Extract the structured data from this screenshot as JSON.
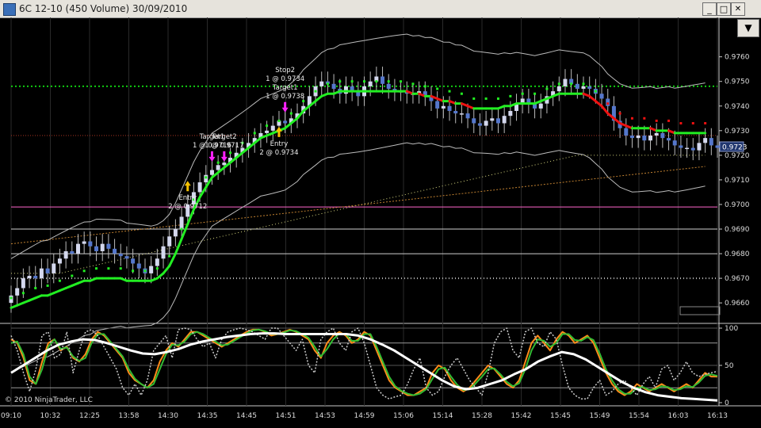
{
  "window": {
    "title": "6C 12-10 (450 Volume)  30/09/2010",
    "min_btn": "_",
    "max_btn": "□",
    "close_btn": "✕",
    "dropdown_glyph": "▼"
  },
  "colors": {
    "bar_up": "#d4d8ee",
    "bar_down": "#5577cc",
    "ma_up": "#22ee22",
    "ma_down": "#ee1111",
    "stoch_k": "#ff8c1a",
    "stoch_d": "#33bb33",
    "stoch_fast": "#cccccc",
    "long_line": "#ffffff",
    "magenta_line": "#ff66cc",
    "green_dotted": "#11cc11",
    "current_price": "#20366e"
  },
  "chart_data": [
    {
      "type": "candlestick",
      "instrument": "6C 12-10",
      "bar_type": "450 Volume",
      "date": "30/09/2010",
      "ylim": [
        0.9652,
        0.9776
      ],
      "y_ticks": [
        "0.9760",
        "0.9750",
        "0.9740",
        "0.9730",
        "0.9720",
        "0.9710",
        "0.9700",
        "0.9690",
        "0.9680",
        "0.9670",
        "0.9660"
      ],
      "x_ticks": [
        "09:10",
        "10:32",
        "12:25",
        "13:58",
        "14:30",
        "14:35",
        "14:45",
        "14:51",
        "14:53",
        "14:59",
        "15:06",
        "15:14",
        "15:28",
        "15:42",
        "15:45",
        "15:49",
        "15:54",
        "16:03",
        "16:13"
      ],
      "current_price_label": "0.9723",
      "closes": [
        0.9663,
        0.9666,
        0.967,
        0.9671,
        0.967,
        0.9674,
        0.9672,
        0.9676,
        0.9678,
        0.9681,
        0.968,
        0.9684,
        0.9685,
        0.9683,
        0.9681,
        0.9684,
        0.9682,
        0.968,
        0.9679,
        0.9678,
        0.9676,
        0.9674,
        0.9672,
        0.9675,
        0.9678,
        0.9683,
        0.9687,
        0.969,
        0.9695,
        0.97,
        0.9705,
        0.9709,
        0.9712,
        0.9714,
        0.9716,
        0.9717,
        0.9719,
        0.9721,
        0.9723,
        0.9725,
        0.9727,
        0.9729,
        0.973,
        0.9732,
        0.9734,
        0.9733,
        0.9735,
        0.9737,
        0.974,
        0.9744,
        0.9748,
        0.975,
        0.9749,
        0.9747,
        0.9745,
        0.9748,
        0.9746,
        0.9744,
        0.9748,
        0.975,
        0.9752,
        0.9749,
        0.9747,
        0.9746,
        0.9746,
        0.9745,
        0.9745,
        0.9746,
        0.9744,
        0.9742,
        0.9739,
        0.974,
        0.9738,
        0.9737,
        0.9737,
        0.9735,
        0.9733,
        0.9732,
        0.9734,
        0.9735,
        0.9733,
        0.9736,
        0.9738,
        0.9741,
        0.9743,
        0.9741,
        0.9739,
        0.9741,
        0.9744,
        0.9746,
        0.9748,
        0.9751,
        0.9749,
        0.9747,
        0.9748,
        0.9747,
        0.9745,
        0.9743,
        0.974,
        0.9734,
        0.9731,
        0.9728,
        0.9727,
        0.9728,
        0.9726,
        0.9728,
        0.9729,
        0.9727,
        0.9726,
        0.9724,
        0.9723,
        0.9723,
        0.9722,
        0.9725,
        0.9727,
        0.9724,
        0.9723
      ],
      "moving_average": [
        0.9658,
        0.9659,
        0.966,
        0.9661,
        0.9662,
        0.9663,
        0.9663,
        0.9664,
        0.9665,
        0.9666,
        0.9667,
        0.9668,
        0.9669,
        0.9669,
        0.967,
        0.967,
        0.967,
        0.967,
        0.967,
        0.9669,
        0.9669,
        0.9669,
        0.9669,
        0.9669,
        0.967,
        0.9672,
        0.9675,
        0.968,
        0.9686,
        0.9692,
        0.9698,
        0.9703,
        0.9707,
        0.9711,
        0.9713,
        0.9715,
        0.9717,
        0.9719,
        0.9721,
        0.9723,
        0.9725,
        0.9727,
        0.9728,
        0.9729,
        0.973,
        0.9731,
        0.9733,
        0.9735,
        0.9738,
        0.974,
        0.9742,
        0.9744,
        0.9745,
        0.9745,
        0.9746,
        0.9746,
        0.9746,
        0.9746,
        0.9746,
        0.9746,
        0.9746,
        0.9746,
        0.9746,
        0.9746,
        0.9746,
        0.9746,
        0.9745,
        0.9745,
        0.9744,
        0.9744,
        0.9743,
        0.9742,
        0.9742,
        0.9741,
        0.9741,
        0.974,
        0.9739,
        0.9739,
        0.9739,
        0.9739,
        0.9739,
        0.974,
        0.974,
        0.9741,
        0.9741,
        0.9741,
        0.9741,
        0.9742,
        0.9743,
        0.9744,
        0.9745,
        0.9745,
        0.9745,
        0.9745,
        0.9745,
        0.9744,
        0.9742,
        0.974,
        0.9737,
        0.9735,
        0.9733,
        0.9732,
        0.9731,
        0.9731,
        0.9731,
        0.9731,
        0.973,
        0.973,
        0.973,
        0.9729,
        0.9729,
        0.9729,
        0.9729,
        0.9729,
        0.9729
      ],
      "trade_markers": [
        {
          "lines": [
            "Entry",
            "2 @ 0.9712"
          ],
          "price": 0.9707,
          "bar": 29,
          "kind": "long"
        },
        {
          "lines": [
            "Target1",
            "1 @ 0.9716"
          ],
          "price": 0.972,
          "bar": 33,
          "kind": "exit"
        },
        {
          "lines": [
            "Target2",
            "1 @ 0.9717"
          ],
          "price": 0.972,
          "bar": 35,
          "kind": "exit"
        },
        {
          "lines": [
            "Entry",
            "2 @ 0.9734"
          ],
          "price": 0.9729,
          "bar": 44,
          "kind": "long"
        },
        {
          "lines": [
            "Stop2",
            "1 @ 0.9734",
            "Target1",
            "1 @ 0.9738"
          ],
          "price": 0.974,
          "bar": 45,
          "kind": "exit"
        }
      ],
      "horizontal_levels": [
        {
          "price": 0.9748,
          "style": "green-dotted"
        },
        {
          "price": 0.9728,
          "style": "red-dotted"
        },
        {
          "price": 0.9699,
          "style": "magenta"
        },
        {
          "price": 0.967,
          "style": "gray-dotted"
        }
      ],
      "copyright": "© 2010 NinjaTrader, LLC"
    },
    {
      "type": "line",
      "ylim": [
        0,
        100
      ],
      "y_ticks": [
        "100",
        "50",
        "0"
      ],
      "series": [
        {
          "role": "stoch_k",
          "values": [
            85,
            80,
            60,
            30,
            25,
            55,
            80,
            85,
            70,
            75,
            60,
            55,
            65,
            85,
            95,
            90,
            80,
            70,
            60,
            40,
            30,
            25,
            20,
            30,
            55,
            70,
            80,
            75,
            85,
            95,
            95,
            90,
            85,
            80,
            75,
            80,
            85,
            90,
            95,
            98,
            98,
            95,
            90,
            92,
            95,
            98,
            95,
            90,
            85,
            70,
            60,
            80,
            90,
            95,
            90,
            80,
            85,
            95,
            90,
            70,
            50,
            30,
            20,
            15,
            10,
            10,
            15,
            20,
            40,
            50,
            45,
            30,
            20,
            15,
            20,
            30,
            40,
            50,
            45,
            35,
            25,
            20,
            30,
            55,
            80,
            90,
            80,
            70,
            85,
            95,
            90,
            80,
            85,
            90,
            80,
            60,
            40,
            25,
            15,
            10,
            15,
            25,
            20,
            15,
            20,
            25,
            20,
            15,
            20,
            25,
            20,
            30,
            40,
            35,
            35
          ]
        },
        {
          "role": "stoch_d",
          "values": [
            80,
            82,
            65,
            35,
            25,
            45,
            75,
            85,
            72,
            74,
            62,
            56,
            60,
            80,
            92,
            92,
            82,
            72,
            62,
            45,
            32,
            25,
            20,
            25,
            45,
            65,
            78,
            77,
            82,
            92,
            95,
            92,
            87,
            82,
            77,
            78,
            83,
            88,
            93,
            97,
            98,
            96,
            92,
            92,
            94,
            97,
            96,
            92,
            87,
            75,
            62,
            72,
            85,
            93,
            92,
            83,
            83,
            92,
            92,
            75,
            55,
            35,
            22,
            16,
            12,
            10,
            12,
            18,
            32,
            45,
            47,
            35,
            24,
            17,
            18,
            26,
            35,
            45,
            46,
            38,
            28,
            22,
            26,
            45,
            70,
            85,
            83,
            75,
            80,
            92,
            92,
            84,
            83,
            88,
            84,
            66,
            45,
            30,
            18,
            12,
            12,
            20,
            21,
            17,
            18,
            22,
            21,
            17,
            18,
            22,
            21,
            27,
            36,
            38,
            36
          ]
        },
        {
          "role": "stoch_fast",
          "values": [
            90,
            70,
            40,
            15,
            45,
            90,
            95,
            60,
            65,
            95,
            40,
            70,
            95,
            98,
            90,
            75,
            60,
            45,
            20,
            10,
            25,
            10,
            30,
            70,
            80,
            90,
            60,
            98,
            100,
            98,
            85,
            75,
            80,
            60,
            85,
            95,
            98,
            100,
            98,
            95,
            90,
            85,
            100,
            100,
            90,
            80,
            70,
            85,
            50,
            40,
            85,
            95,
            100,
            80,
            70,
            95,
            100,
            80,
            50,
            20,
            10,
            5,
            8,
            10,
            25,
            45,
            60,
            20,
            10,
            15,
            35,
            50,
            60,
            45,
            30,
            20,
            10,
            40,
            80,
            95,
            100,
            70,
            60,
            95,
            100,
            80,
            75,
            95,
            85,
            50,
            20,
            10,
            5,
            5,
            20,
            30,
            10,
            15,
            25,
            30,
            20,
            10,
            25,
            35,
            20,
            45,
            50,
            30,
            40,
            55,
            40,
            35,
            38,
            40,
            42
          ]
        },
        {
          "role": "long_line",
          "values": [
            40,
            50,
            60,
            70,
            78,
            82,
            85,
            84,
            80,
            75,
            70,
            66,
            65,
            68,
            72,
            78,
            82,
            85,
            88,
            90,
            92,
            93,
            93,
            92,
            92,
            92,
            92,
            92,
            92,
            90,
            85,
            78,
            70,
            60,
            50,
            40,
            30,
            22,
            18,
            20,
            25,
            30,
            38,
            45,
            55,
            62,
            68,
            65,
            58,
            48,
            38,
            28,
            20,
            14,
            10,
            8,
            6,
            5,
            4,
            3
          ]
        }
      ]
    }
  ]
}
